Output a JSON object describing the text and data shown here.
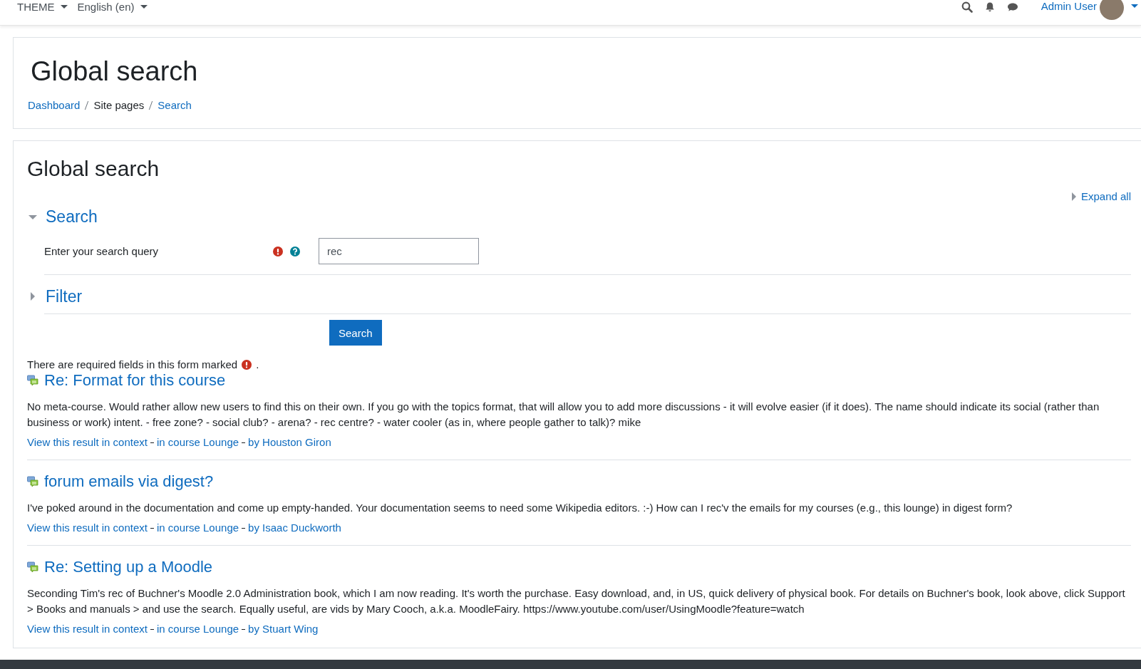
{
  "navbar": {
    "menus": [
      {
        "label": "THEME"
      },
      {
        "label": "English (en)"
      }
    ],
    "user": "Admin User"
  },
  "header": {
    "title": "Global search",
    "breadcrumb": [
      {
        "label": "Dashboard",
        "link": true
      },
      {
        "label": "Site pages",
        "link": false
      },
      {
        "label": "Search",
        "link": true
      }
    ]
  },
  "main": {
    "title": "Global search",
    "expand_all": "Expand all",
    "sections": [
      {
        "title": "Search",
        "expanded": true,
        "field": {
          "label": "Enter your search query",
          "value": "rec"
        }
      },
      {
        "title": "Filter",
        "expanded": false
      }
    ],
    "submit": "Search",
    "required_note": {
      "before": "There are required fields in this form marked",
      "after": "."
    }
  },
  "results": [
    {
      "title": "Re: Format for this course",
      "text": "No meta-course. Would rather allow new users to find this on their own. If you go with the topics format, that will allow you to add more discussions - it will evolve easier (if it does). The name should indicate its social (rather than business or work) intent. - free zone? - social club? - arena? - rec centre? - water cooler (as in, where people gather to talk)? mike",
      "links": [
        "View this result in context",
        "in course Lounge",
        "by Houston Giron"
      ]
    },
    {
      "title": "forum emails via digest?",
      "text": "I've poked around in the documentation and come up empty-handed. Your documentation seems to need some Wikipedia editors. :-) How can I rec'v the emails for my courses (e.g., this lounge) in digest form?",
      "links": [
        "View this result in context",
        "in course Lounge",
        "by Isaac Duckworth"
      ]
    },
    {
      "title": "Re: Setting up a Moodle",
      "text": "Seconding Tim's rec of Buchner's Moodle 2.0 Administration book, which I am now reading. It's worth the purchase. Easy download, and, in US, quick delivery of physical book. For details on Buchner's book, look above, click Support > Books and manuals > and use the search. Equally useful, are vids by Mary Cooch, a.k.a. MoodleFairy. https://www.youtube.com/user/UsingMoodle?feature=watch",
      "links": [
        "View this result in context",
        "in course Lounge",
        "by Stuart Wing"
      ]
    }
  ]
}
